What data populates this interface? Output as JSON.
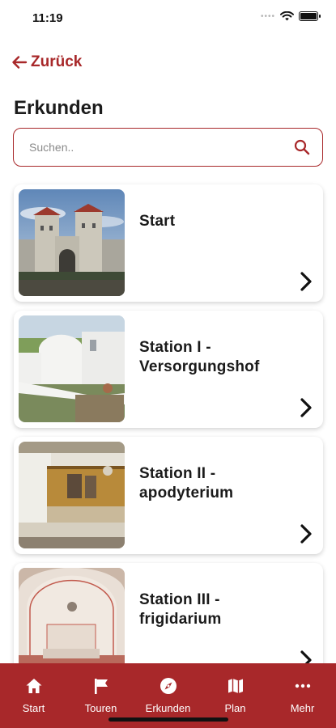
{
  "status_bar": {
    "time": "11:19",
    "signal": "••••"
  },
  "header": {
    "back_label": "Zurück",
    "title": "Erkunden"
  },
  "search": {
    "placeholder": "Suchen.."
  },
  "stations": [
    {
      "title": "Start"
    },
    {
      "title": "Station I - Versorgungshof"
    },
    {
      "title": "Station II - apodyterium"
    },
    {
      "title": "Station III - frigidarium"
    }
  ],
  "tabbar": {
    "items": [
      {
        "label": "Start",
        "icon": "home-icon"
      },
      {
        "label": "Touren",
        "icon": "flag-icon"
      },
      {
        "label": "Erkunden",
        "icon": "compass-icon"
      },
      {
        "label": "Plan",
        "icon": "map-icon"
      },
      {
        "label": "Mehr",
        "icon": "more-icon"
      }
    ]
  },
  "colors": {
    "accent": "#a8282a",
    "background": "#ffffff"
  }
}
